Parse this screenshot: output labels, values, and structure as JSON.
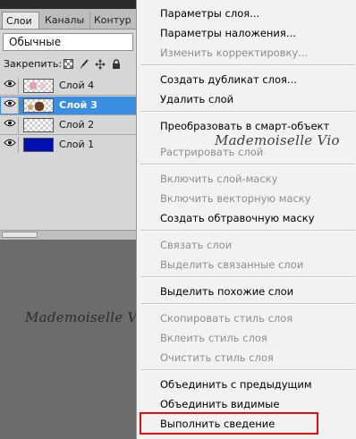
{
  "panel": {
    "tabs": [
      "Слои",
      "Каналы",
      "Контур"
    ],
    "blend_mode": "Обычные",
    "lock_label": "Закрепить:",
    "lock_icons": [
      "lock-transparency-icon",
      "lock-paint-icon",
      "lock-move-icon",
      "lock-all-icon"
    ],
    "layers": [
      {
        "name": "Слой 4",
        "selected": false
      },
      {
        "name": "Слой 3",
        "selected": true
      },
      {
        "name": "Слой 2",
        "selected": false
      },
      {
        "name": "Слой 1",
        "selected": false
      }
    ]
  },
  "watermark": "Mademoiselle Vio",
  "menu": {
    "items": [
      {
        "label": "Параметры слоя...",
        "enabled": true
      },
      {
        "label": "Параметры наложения...",
        "enabled": true
      },
      {
        "label": "Изменить корректировку...",
        "enabled": false
      },
      {
        "label": "Создать дубликат слоя...",
        "enabled": true
      },
      {
        "label": "Удалить слой",
        "enabled": true
      },
      {
        "label": "Преобразовать в смарт-объект",
        "enabled": true
      },
      {
        "label": "Растрировать слой",
        "enabled": false
      },
      {
        "label": "Включить слой-маску",
        "enabled": false
      },
      {
        "label": "Включить векторную маску",
        "enabled": false
      },
      {
        "label": "Создать обтравочную маску",
        "enabled": true
      },
      {
        "label": "Связать слои",
        "enabled": false
      },
      {
        "label": "Выделить связанные слои",
        "enabled": false
      },
      {
        "label": "Выделить похожие слои",
        "enabled": true
      },
      {
        "label": "Скопировать стиль слоя",
        "enabled": false
      },
      {
        "label": "Вклеить стиль слоя",
        "enabled": false
      },
      {
        "label": "Очистить стиль слоя",
        "enabled": false
      },
      {
        "label": "Объединить с предыдущим",
        "enabled": true
      },
      {
        "label": "Объединить видимые",
        "enabled": true
      },
      {
        "label": "Выполнить сведение",
        "enabled": true
      }
    ]
  },
  "colors": {
    "selected_layer": "#3b8fe2",
    "highlight_box": "#e01010",
    "disabled_text": "#8e8e8e"
  }
}
